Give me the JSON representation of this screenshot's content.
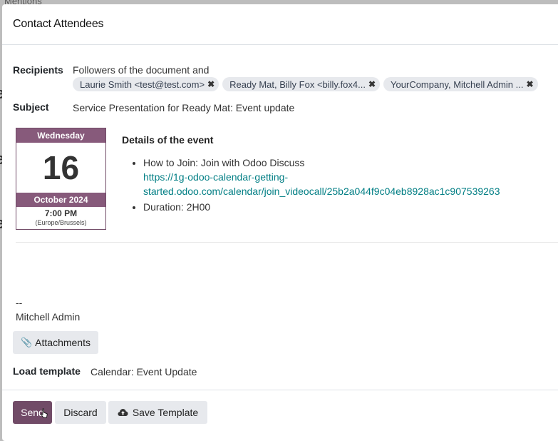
{
  "backdrop": {
    "top_text": "Mentions"
  },
  "dialog": {
    "title": "Contact Attendees",
    "recipients": {
      "label": "Recipients",
      "prefix": "Followers of the document and",
      "tags": [
        {
          "text": "Laurie Smith <test@test.com>"
        },
        {
          "text": "Ready Mat, Billy Fox <billy.fox4..."
        },
        {
          "text": "YourCompany, Mitchell Admin ..."
        }
      ]
    },
    "subject": {
      "label": "Subject",
      "value": "Service Presentation for Ready Mat: Event update"
    },
    "calendar": {
      "weekday": "Wednesday",
      "day": "16",
      "month_year": "October 2024",
      "time": "7:00 PM",
      "timezone": "(Europe/Brussels)"
    },
    "details": {
      "title": "Details of the event",
      "join_label": "How to Join: Join with Odoo Discuss",
      "join_url": "https://1g-odoo-calendar-getting-started.odoo.com/calendar/join_videocall/25b2a044f9c04eb8928ac1c907539263",
      "join_url_line1": "https://1g-odoo-calendar-getting-",
      "join_url_line2": "started.odoo.com/calendar/join_videocall/25b2a044f9c04eb8928ac1c907539263",
      "duration": "Duration: 2H00"
    },
    "signature": {
      "dashes": "--",
      "name": "Mitchell Admin"
    },
    "attachments_label": "Attachments",
    "template": {
      "label": "Load template",
      "value": "Calendar: Event Update"
    },
    "buttons": {
      "send": "Send",
      "discard": "Discard",
      "save_template": "Save Template"
    },
    "colors": {
      "brand": "#714B67",
      "brand_light": "#875A7B",
      "link": "#017e84"
    }
  }
}
